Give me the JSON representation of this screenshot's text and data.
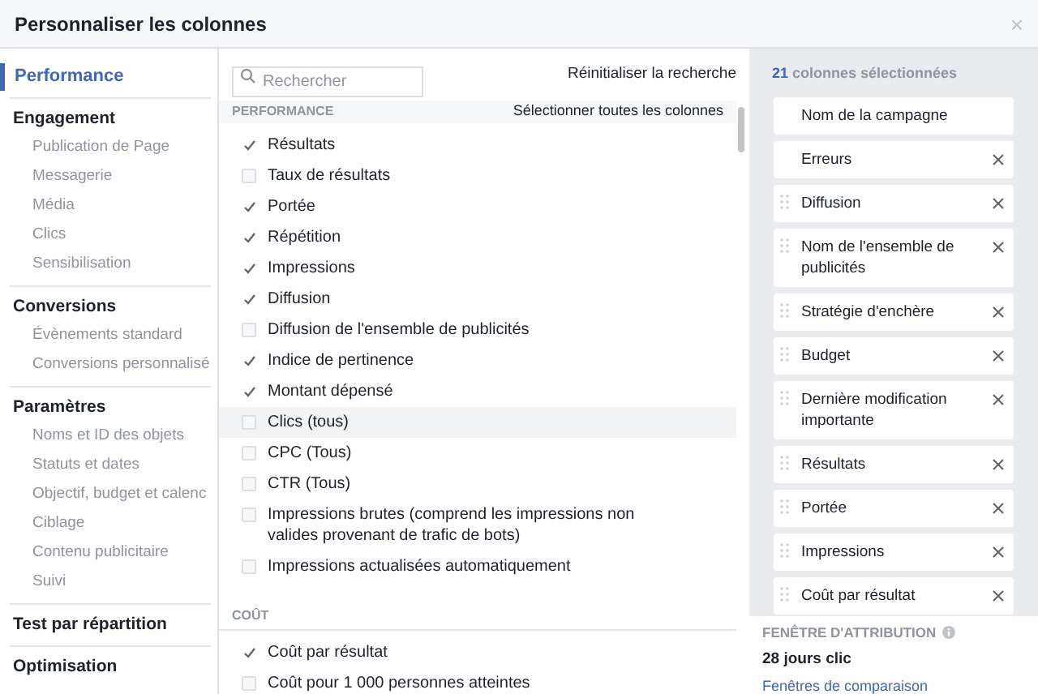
{
  "dialog": {
    "title": "Personnaliser les colonnes",
    "close": "×"
  },
  "sidebar": [
    {
      "heading": "Performance",
      "selected": true
    },
    {
      "heading": "Engagement",
      "selected": false,
      "items": [
        "Publication de Page",
        "Messagerie",
        "Média",
        "Clics",
        "Sensibilisation"
      ]
    },
    {
      "heading": "Conversions",
      "selected": false,
      "items": [
        "Évènements standard",
        "Conversions personnalisé"
      ]
    },
    {
      "heading": "Paramètres",
      "selected": false,
      "items": [
        "Noms et ID des objets",
        "Statuts et dates",
        "Objectif, budget et calenc",
        "Ciblage",
        "Contenu publicitaire",
        "Suivi"
      ]
    },
    {
      "heading": "Test par répartition",
      "selected": false
    },
    {
      "heading": "Optimisation",
      "selected": false
    }
  ],
  "search": {
    "placeholder": "Rechercher",
    "reset": "Réinitialiser la recherche"
  },
  "groups": [
    {
      "heading": "PERFORMANCE",
      "action": "Sélectionner toutes les colonnes",
      "options": [
        {
          "label": "Résultats",
          "checked": true,
          "hovered": false
        },
        {
          "label": "Taux de résultats",
          "checked": false,
          "hovered": false
        },
        {
          "label": "Portée",
          "checked": true,
          "hovered": false
        },
        {
          "label": "Répétition",
          "checked": true,
          "hovered": false
        },
        {
          "label": "Impressions",
          "checked": true,
          "hovered": false
        },
        {
          "label": "Diffusion",
          "checked": true,
          "hovered": false
        },
        {
          "label": "Diffusion de l'ensemble de publicités",
          "checked": false,
          "hovered": false
        },
        {
          "label": "Indice de pertinence",
          "checked": true,
          "hovered": false
        },
        {
          "label": "Montant dépensé",
          "checked": true,
          "hovered": false
        },
        {
          "label": "Clics (tous)",
          "checked": false,
          "hovered": true
        },
        {
          "label": "CPC (Tous)",
          "checked": false,
          "hovered": false
        },
        {
          "label": "CTR (Tous)",
          "checked": false,
          "hovered": false
        },
        {
          "label": "Impressions brutes (comprend les impressions non valides provenant de trafic de bots)",
          "checked": false,
          "hovered": false
        },
        {
          "label": "Impressions actualisées automatiquement",
          "checked": false,
          "hovered": false
        }
      ]
    },
    {
      "heading": "COÛT",
      "options": [
        {
          "label": "Coût par résultat",
          "checked": true,
          "hovered": false
        },
        {
          "label": "Coût pour 1 000 personnes atteintes",
          "checked": false,
          "hovered": false
        }
      ]
    }
  ],
  "selected_columns": {
    "count": "21",
    "label": "colonnes sélectionnées",
    "items": [
      {
        "label": "Nom de la campagne",
        "draggable": false,
        "removable": false
      },
      {
        "label": "Erreurs",
        "draggable": false,
        "removable": true
      },
      {
        "label": "Diffusion",
        "draggable": true,
        "removable": true
      },
      {
        "label": "Nom de l'ensemble de publicités",
        "draggable": true,
        "removable": true
      },
      {
        "label": "Stratégie d'enchère",
        "draggable": true,
        "removable": true
      },
      {
        "label": "Budget",
        "draggable": true,
        "removable": true
      },
      {
        "label": "Dernière modification importante",
        "draggable": true,
        "removable": true
      },
      {
        "label": "Résultats",
        "draggable": true,
        "removable": true
      },
      {
        "label": "Portée",
        "draggable": true,
        "removable": true
      },
      {
        "label": "Impressions",
        "draggable": true,
        "removable": true
      },
      {
        "label": "Coût par résultat",
        "draggable": true,
        "removable": true
      }
    ]
  },
  "attribution": {
    "heading": "FENÊTRE D'ATTRIBUTION",
    "value": "28 jours clic",
    "link": "Fenêtres de comparaison"
  }
}
